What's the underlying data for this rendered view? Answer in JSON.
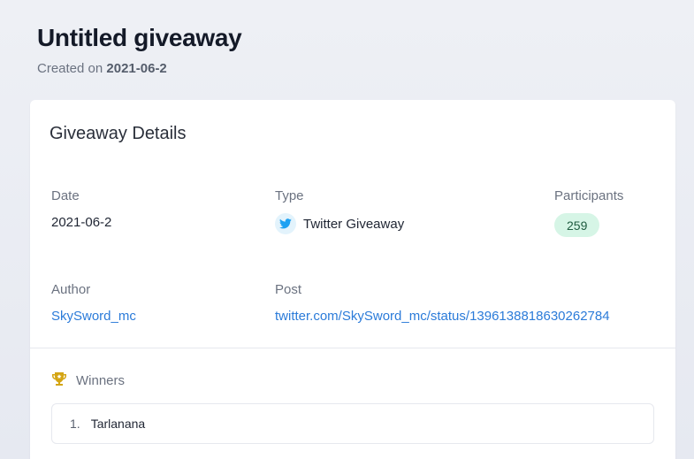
{
  "header": {
    "title": "Untitled giveaway",
    "created_prefix": "Created on",
    "created_date": "2021-06-2"
  },
  "card": {
    "title": "Giveaway Details",
    "date": {
      "label": "Date",
      "value": "2021-06-2"
    },
    "type": {
      "label": "Type",
      "value": "Twitter Giveaway",
      "icon": "twitter-icon"
    },
    "participants": {
      "label": "Participants",
      "value": "259"
    },
    "author": {
      "label": "Author",
      "value": "SkySword_mc"
    },
    "post": {
      "label": "Post",
      "value": "twitter.com/SkySword_mc/status/1396138818630262784"
    },
    "winners": {
      "label": "Winners",
      "icon": "trophy-icon",
      "items": [
        {
          "rank": "1.",
          "name": "Tarlanana"
        }
      ]
    }
  },
  "colors": {
    "accent_link": "#2b7bd9",
    "twitter_blue": "#1da1f2",
    "trophy_gold": "#d4a514",
    "pill_bg": "#d6f5e6"
  }
}
